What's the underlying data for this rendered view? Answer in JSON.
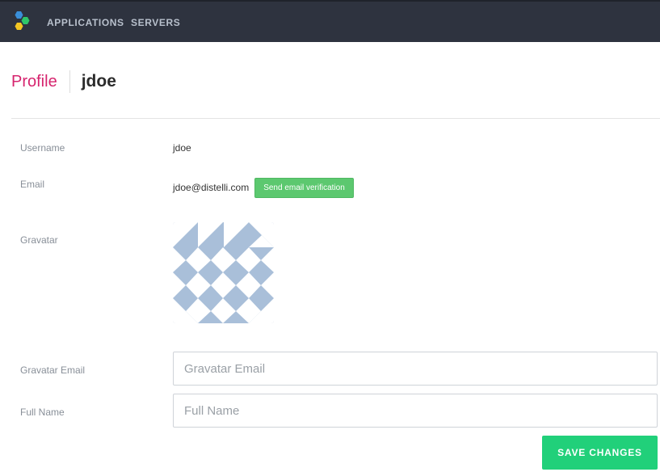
{
  "nav": {
    "logo_icon": "distelli-logo-icon",
    "items": [
      {
        "label": "APPLICATIONS"
      },
      {
        "label": "SERVERS"
      }
    ]
  },
  "header": {
    "title": "Profile",
    "username": "jdoe"
  },
  "profile": {
    "username_label": "Username",
    "username_value": "jdoe",
    "email_label": "Email",
    "email_value": "jdoe@distelli.com",
    "verify_button": "Send email verification",
    "gravatar_label": "Gravatar",
    "gravatar_email_label": "Gravatar Email",
    "gravatar_email_value": "",
    "gravatar_email_placeholder": "Gravatar Email",
    "full_name_label": "Full Name",
    "full_name_value": "",
    "full_name_placeholder": "Full Name",
    "save_button": "SAVE CHANGES"
  },
  "colors": {
    "topbar": "#2e333f",
    "title_accent": "#d6246e",
    "verify_button": "#5cc86f",
    "save_button": "#21d07a",
    "gravatar_pattern": "#a9bfd9"
  }
}
